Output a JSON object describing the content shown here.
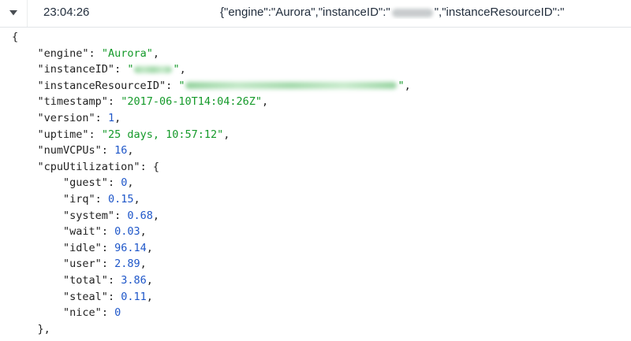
{
  "row": {
    "time": "23:04:26",
    "message_prefix": "{\"engine\":\"Aurora\",\"instanceID\":\"",
    "message_suffix": "\",\"instanceResourceID\":\""
  },
  "json": {
    "open_brace": "{",
    "close_obj": "},",
    "engine_key": "\"engine\"",
    "engine_val": "\"Aurora\"",
    "instanceID_key": "\"instanceID\"",
    "instanceResourceID_key": "\"instanceResourceID\"",
    "timestamp_key": "\"timestamp\"",
    "timestamp_val": "\"2017-06-10T14:04:26Z\"",
    "version_key": "\"version\"",
    "version_val": "1",
    "uptime_key": "\"uptime\"",
    "uptime_val": "\"25 days, 10:57:12\"",
    "numVCPUs_key": "\"numVCPUs\"",
    "numVCPUs_val": "16",
    "cpu_key": "\"cpuUtilization\"",
    "cpu": [
      {
        "key": "\"guest\"",
        "val": "0"
      },
      {
        "key": "\"irq\"",
        "val": "0.15"
      },
      {
        "key": "\"system\"",
        "val": "0.68"
      },
      {
        "key": "\"wait\"",
        "val": "0.03"
      },
      {
        "key": "\"idle\"",
        "val": "96.14"
      },
      {
        "key": "\"user\"",
        "val": "2.89"
      },
      {
        "key": "\"total\"",
        "val": "3.86"
      },
      {
        "key": "\"steal\"",
        "val": "0.11"
      },
      {
        "key": "\"nice\"",
        "val": "0"
      }
    ]
  },
  "icons": {
    "toggle": "caret-down-icon"
  },
  "colors": {
    "string": "#159a2a",
    "number": "#1f57c9",
    "text": "#222222"
  }
}
